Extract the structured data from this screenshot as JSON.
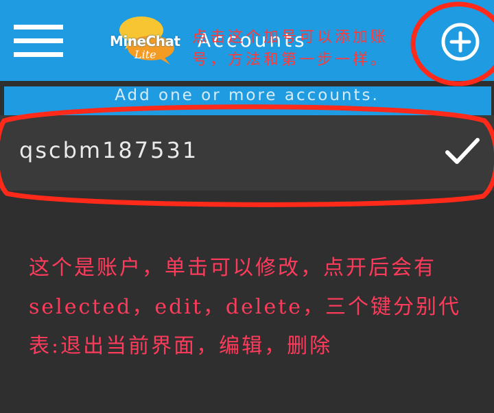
{
  "app_bar": {
    "logo_name": "MineChat",
    "logo_sub": "Lite",
    "title": "Accounts",
    "add_icon": "plus-circle-icon",
    "menu_icon": "hamburger-menu-icon",
    "background_color": "#1e9be1"
  },
  "hint": {
    "text": "Add one or more accounts."
  },
  "accounts": [
    {
      "name": "qscbm187531",
      "status_icon": "checkmark-icon"
    }
  ],
  "annotations": {
    "add_button_note": "点击这个加号可以添加账号，方法和第一步一样。",
    "account_note": "这个是账户，单击可以修改，点开后会有selected，edit，delete，三个键分别代表:退出当前界面，编辑，删除",
    "color": "#ff2a1a"
  }
}
